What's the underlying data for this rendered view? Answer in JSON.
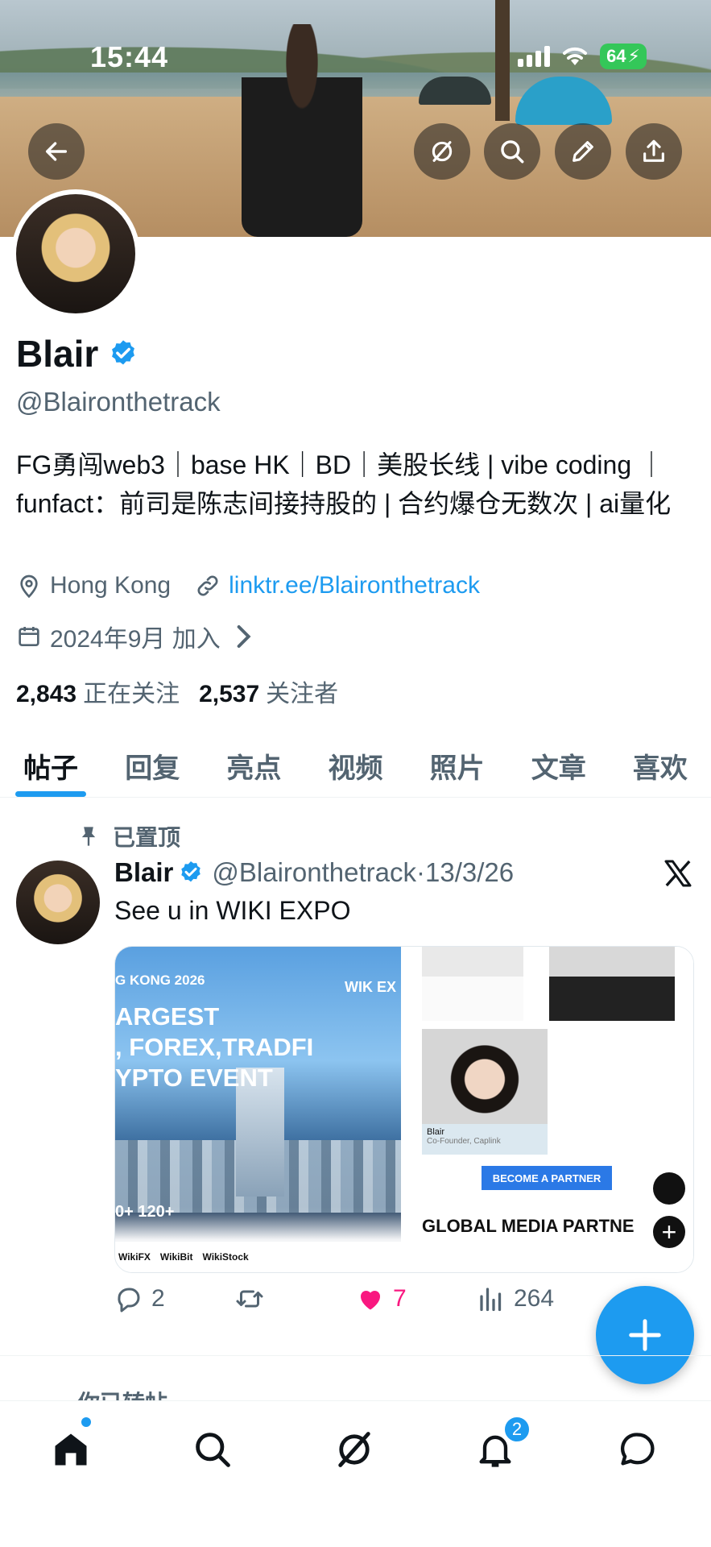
{
  "status_bar": {
    "time": "15:44",
    "battery": "64"
  },
  "header": {
    "buttons": [
      "back-icon",
      "grok-icon",
      "search-icon",
      "edit-icon",
      "share-icon"
    ]
  },
  "profile": {
    "name": "Blair",
    "handle": "@Blaironthetrack",
    "bio": "FG勇闯web3｜base HK｜BD｜美股长线 | vibe coding ｜funfact：前司是陈志间接持股的 | 合约爆仓无数次 | ai量化",
    "location": "Hong Kong",
    "link": "linktr.ee/Blaironthetrack",
    "joined": "2024年9月 加入",
    "following_count": "2,843",
    "following_label": "正在关注",
    "followers_count": "2,537",
    "followers_label": "关注者"
  },
  "tabs": [
    {
      "label": "帖子",
      "active": true
    },
    {
      "label": "回复",
      "active": false
    },
    {
      "label": "亮点",
      "active": false
    },
    {
      "label": "视频",
      "active": false
    },
    {
      "label": "照片",
      "active": false
    },
    {
      "label": "文章",
      "active": false
    },
    {
      "label": "喜欢",
      "active": false
    }
  ],
  "post": {
    "pinned_label": "已置顶",
    "author": "Blair",
    "handle": "@Blaironthetrack",
    "dot": "·",
    "date": "13/3/26",
    "text": "See u in WIKI EXPO",
    "media": {
      "left_top": "G KONG 2026",
      "left_big_1": "ARGEST",
      "left_big_2": ", FOREX,TRADFI",
      "left_big_3": "YPTO EVENT",
      "left_expo": "WIK EX",
      "left_stats": "0+        120+",
      "left_footer_1": "WikiFX",
      "left_footer_2": "WikiBit",
      "left_footer_3": "WikiStock",
      "caption_name": "Blair",
      "caption_title": "Co-Founder, Caplink",
      "partner_button": "BECOME A PARTNER",
      "partners_title": "GLOBAL MEDIA PARTNE"
    },
    "replies": "2",
    "likes": "7",
    "views": "264"
  },
  "next_post": {
    "label": "你已转帖"
  },
  "bottom_nav": {
    "items": [
      "home-icon",
      "search-icon",
      "grok-icon",
      "notifications-icon",
      "messages-icon"
    ],
    "notification_badge": "2"
  },
  "colors": {
    "accent": "#1d9bf0",
    "like": "#f91880",
    "secondary_text": "#536471"
  }
}
